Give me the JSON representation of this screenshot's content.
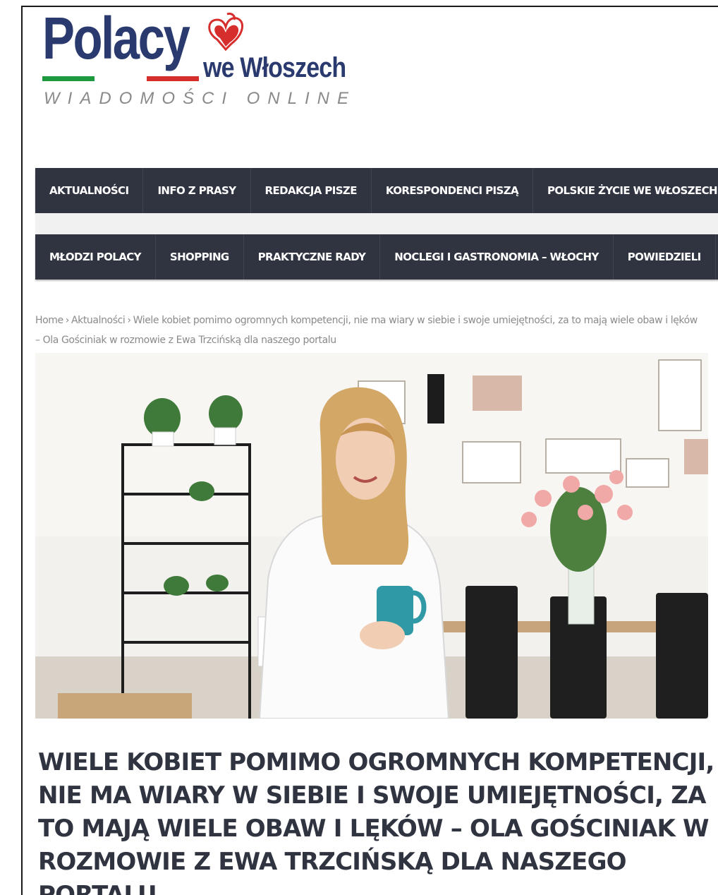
{
  "logo": {
    "name_main": "Polacy",
    "name_suffix": "we Włoszech",
    "tagline": "WIADOMOŚCI ONLINE",
    "flag_colors": [
      "#1e9a3e",
      "#ffffff",
      "#d62d2d"
    ],
    "accent_color": "#d62d2d"
  },
  "nav_primary": [
    {
      "label": "AKTUALNOŚCI"
    },
    {
      "label": "INFO Z PRASY"
    },
    {
      "label": "REDAKCJA PISZE"
    },
    {
      "label": "KORESPONDENCI PISZĄ"
    },
    {
      "label": "POLSKIE ŻYCIE WE WŁOSZECH"
    }
  ],
  "nav_secondary": [
    {
      "label": "MŁODZI POLACY"
    },
    {
      "label": "SHOPPING"
    },
    {
      "label": "PRAKTYCZNE RADY"
    },
    {
      "label": "NOCLEGI I GASTRONOMIA – WŁOCHY"
    },
    {
      "label": "POWIEDZIELI"
    }
  ],
  "breadcrumb": {
    "home": "Home",
    "section": "Aktualności",
    "separator": "›",
    "current": "Wiele kobiet pomimo ogromnych kompetencji, nie ma wiary w siebie i swoje umiejętności, za to mają wiele obaw i lęków – Ola Gościniak w rozmowie z Ewa Trzcińską dla naszego portalu"
  },
  "article": {
    "title": "Wiele kobiet pomimo ogromnych kompetencji, nie ma wiary w siebie i swoje umiejętności, za to mają wiele obaw i lęków – Ola Gościniak w rozmowie z Ewa Trzcińską dla naszego portalu"
  },
  "colors": {
    "nav_bg": "#2f3440",
    "title_color": "#2f3440",
    "breadcrumb_color": "#8a8a8a"
  }
}
